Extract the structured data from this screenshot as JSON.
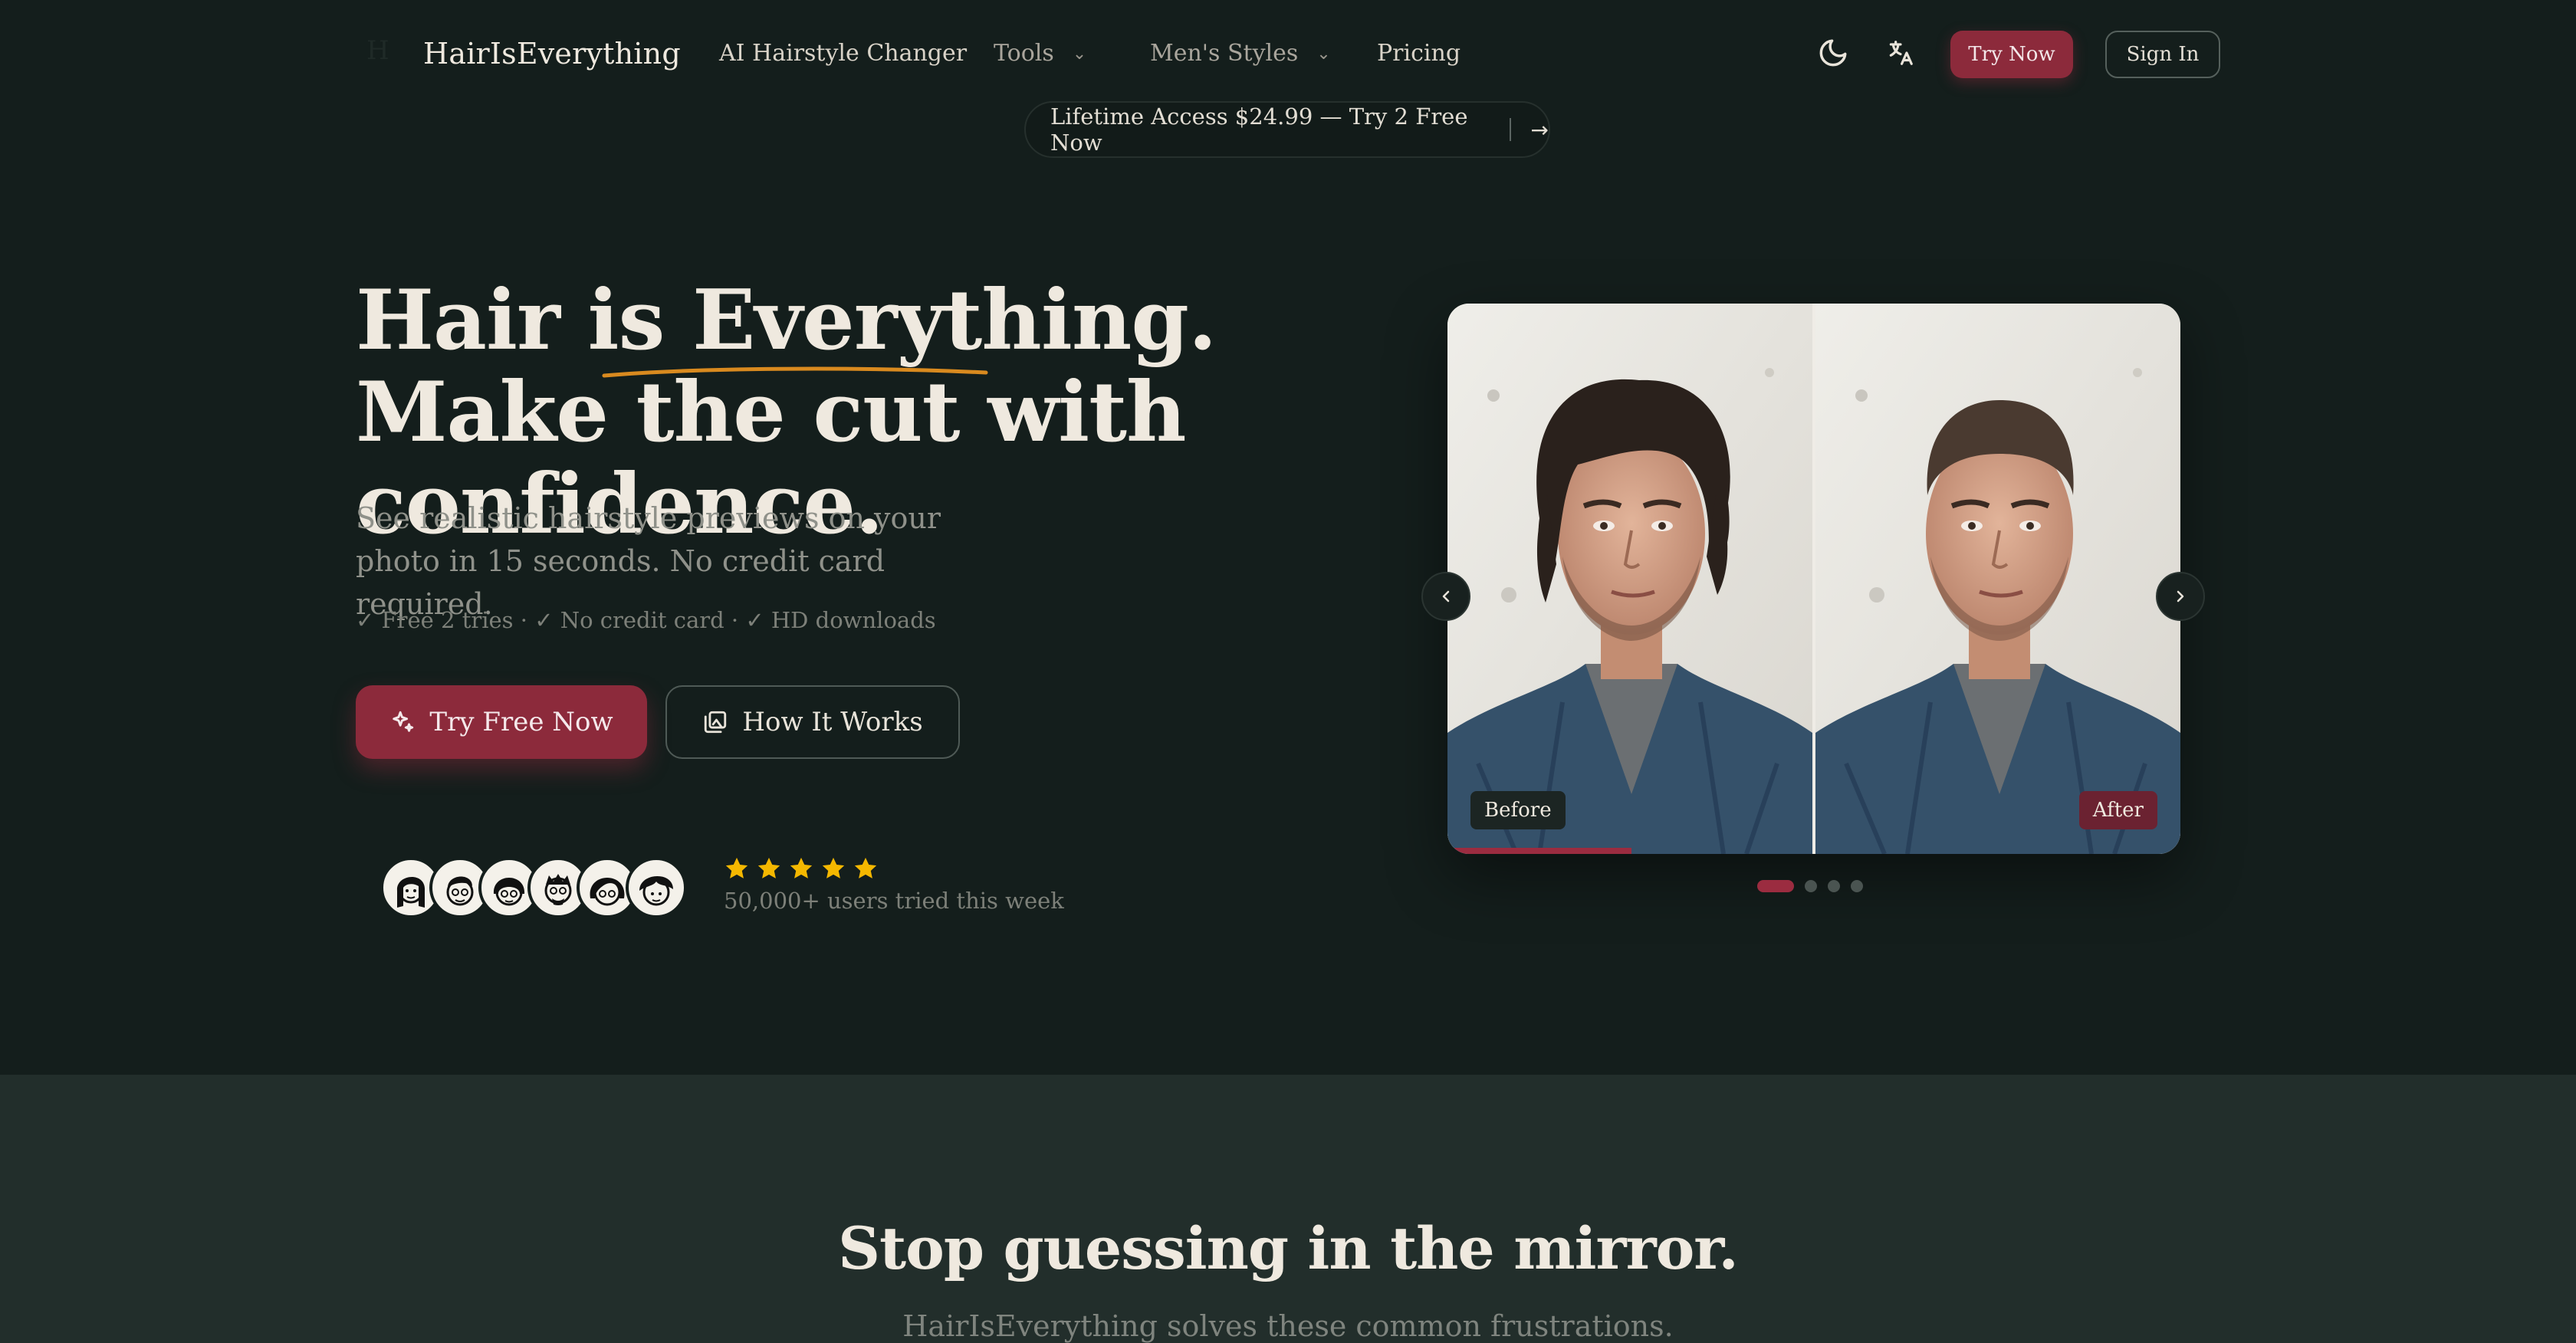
{
  "header": {
    "logo_mark": "H",
    "brand": "HairIsEverything",
    "nav": [
      {
        "label": "AI Hairstyle Changer"
      },
      {
        "label": "Tools"
      },
      {
        "label": "Men's Styles"
      },
      {
        "label": "Pricing"
      }
    ],
    "try_now": "Try Now",
    "sign_in": "Sign In",
    "icons": [
      "moon-icon",
      "translate-icon"
    ]
  },
  "promo": {
    "text": "Lifetime Access $24.99 — Try 2 Free Now",
    "arrow": "→"
  },
  "hero": {
    "title_a": "Hair is ",
    "title_highlight": "Everything",
    "title_b": ". Make the cut with confidence.",
    "subtitle": "See realistic hairstyle previews on your photo in 15 seconds. No credit card required.",
    "checks": "✓ Free 2 tries · ✓ No credit card · ✓ HD downloads",
    "primary_button": "Try Free Now",
    "secondary_button": "How It Works",
    "social_proof": "50,000+ users tried this week",
    "rating": 5
  },
  "preview": {
    "before_label": "Before",
    "after_label": "After",
    "slide_count": 4,
    "active_slide": 0
  },
  "section2": {
    "title": "Stop guessing in the mirror.",
    "subtitle": "HairIsEverything solves these common frustrations."
  },
  "colors": {
    "background": "#141e1c",
    "accent": "#8c2a3b",
    "underline": "#d98a1f",
    "star": "#f5b800"
  }
}
